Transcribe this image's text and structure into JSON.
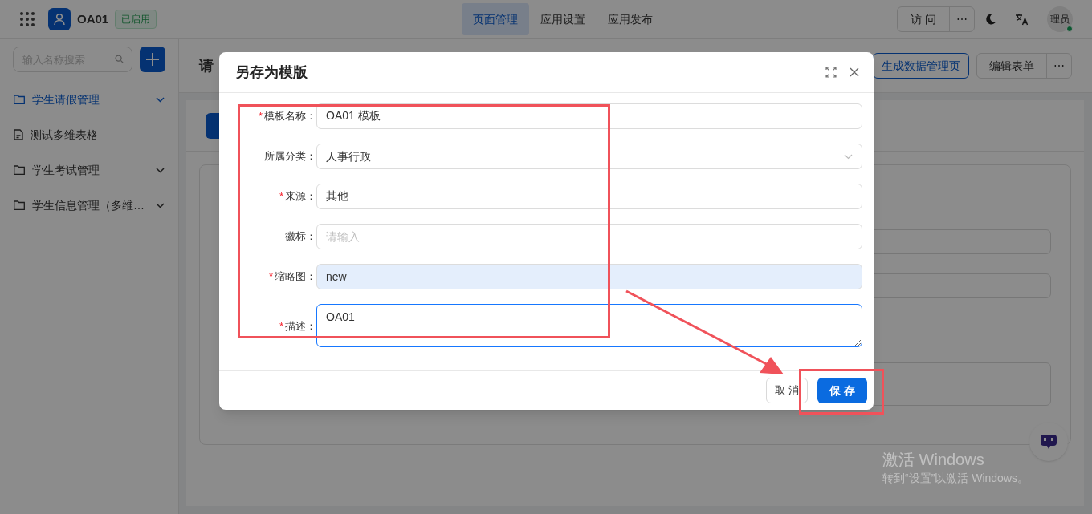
{
  "topbar": {
    "app_name": "OA01",
    "status_badge": "已启用",
    "tabs": [
      {
        "label": "页面管理",
        "selected": true
      },
      {
        "label": "应用设置",
        "selected": false
      },
      {
        "label": "应用发布",
        "selected": false
      }
    ],
    "visit_button": "访 问",
    "more_button": "⋯",
    "user_avatar": "理员",
    "user_online": true
  },
  "sidebar": {
    "search": {
      "placeholder": "输入名称搜索"
    },
    "items": [
      {
        "kind": "folder",
        "label": "学生请假管理",
        "selected": true
      },
      {
        "kind": "page",
        "label": "测试多维表格",
        "selected": false
      },
      {
        "kind": "folder",
        "label": "学生考试管理",
        "selected": false
      },
      {
        "kind": "folder",
        "label": "学生信息管理（多维…",
        "selected": false
      }
    ]
  },
  "page": {
    "title": "请",
    "actions": [
      "生成数据管理页",
      "编辑表单"
    ],
    "more_button": "⋯"
  },
  "dialog": {
    "title": "另存为模版",
    "fields": [
      {
        "kind": "input",
        "required_mark": "*",
        "label": "模板名称：",
        "value": "OA01 模板",
        "autofilled": false,
        "focused": false
      },
      {
        "kind": "select",
        "label": "所属分类：",
        "value": "人事行政",
        "autofilled": false,
        "focused": false
      },
      {
        "kind": "input",
        "required_mark": "*",
        "label": "来源：",
        "value": "其他",
        "autofilled": false,
        "focused": false
      },
      {
        "kind": "input",
        "label": "徽标：",
        "placeholder": "请输入",
        "autofilled": false,
        "focused": false
      },
      {
        "kind": "input",
        "required_mark": "*",
        "label": "缩略图：",
        "value": "new",
        "autofilled": true,
        "focused": false
      },
      {
        "kind": "textarea",
        "required_mark": "*",
        "label": "描述：",
        "value": "OA01",
        "autofilled": false,
        "focused": true
      }
    ],
    "buttons": [
      {
        "label": "取 消",
        "primary": false
      },
      {
        "label": "保 存",
        "primary": true
      }
    ]
  },
  "os_notice": {
    "title": "激活 Windows",
    "text": "转到“设置”以激活 Windows。"
  }
}
